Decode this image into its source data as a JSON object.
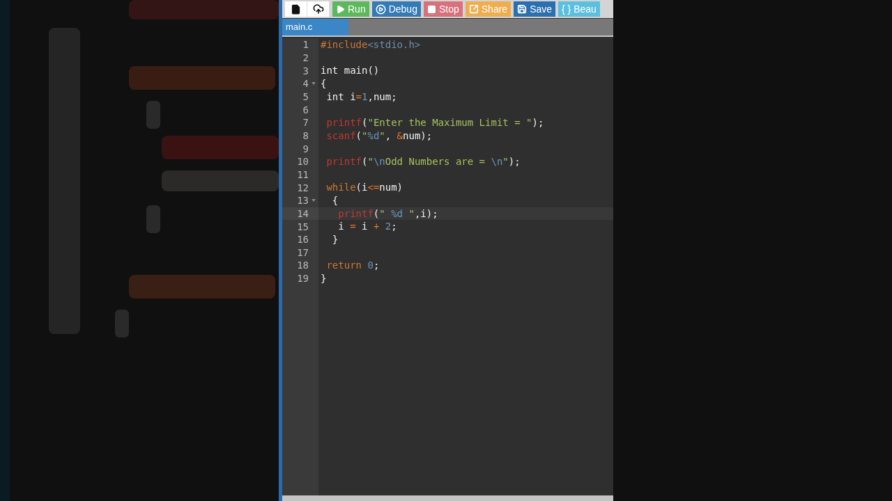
{
  "toolbar": {
    "icon_buttons": [
      {
        "kind": "new-file"
      },
      {
        "kind": "upload"
      }
    ],
    "buttons": [
      {
        "label": "Run",
        "kind": "play",
        "color": "#5cb85c"
      },
      {
        "label": "Debug",
        "kind": "debug",
        "color": "#337ab7"
      },
      {
        "label": "Stop",
        "kind": "stop",
        "color": "#d9707a"
      },
      {
        "label": "Share",
        "kind": "share",
        "color": "#f0ad4e"
      },
      {
        "label": "Save",
        "kind": "save",
        "color": "#2a6fb0"
      },
      {
        "label": "{ } Beau",
        "kind": "text",
        "color": "#5bc0de"
      }
    ]
  },
  "tabs": [
    {
      "label": "main.c",
      "selected": true
    }
  ],
  "editor": {
    "lines": [
      {
        "number": "1",
        "foldable": false,
        "active": false,
        "tokens": [
          {
            "kind": "directive",
            "text": "#include"
          },
          {
            "kind": "header",
            "text": "<stdio.h>"
          }
        ]
      },
      {
        "number": "2",
        "foldable": false,
        "active": false
      },
      {
        "number": "3",
        "foldable": false,
        "active": false,
        "tokens": [
          {
            "kind": "plain",
            "text": "int main()"
          }
        ]
      },
      {
        "number": "4",
        "foldable": true,
        "active": false,
        "tokens": [
          {
            "kind": "plain",
            "text": "{"
          }
        ]
      },
      {
        "number": "5",
        "foldable": false,
        "active": false,
        "tokens": [
          {
            "kind": "plain",
            "text": " int i"
          },
          {
            "kind": "operator",
            "text": "="
          },
          {
            "kind": "number",
            "text": "1"
          },
          {
            "kind": "plain",
            "text": ",num;"
          }
        ]
      },
      {
        "number": "6",
        "foldable": false,
        "active": false
      },
      {
        "number": "7",
        "foldable": false,
        "active": false,
        "tokens": [
          {
            "kind": "func",
            "text": " printf"
          },
          {
            "kind": "plain",
            "text": "("
          },
          {
            "kind": "string",
            "text": "\"Enter the Maximum Limit = \""
          },
          {
            "kind": "plain",
            "text": ");"
          }
        ]
      },
      {
        "number": "8",
        "foldable": false,
        "active": false,
        "tokens": [
          {
            "kind": "func",
            "text": " scanf"
          },
          {
            "kind": "plain",
            "text": "("
          },
          {
            "kind": "string",
            "text": "\""
          },
          {
            "kind": "escape",
            "text": "%d"
          },
          {
            "kind": "string",
            "text": "\""
          },
          {
            "kind": "plain",
            "text": ", "
          },
          {
            "kind": "operator",
            "text": "&"
          },
          {
            "kind": "plain",
            "text": "num);"
          }
        ]
      },
      {
        "number": "9",
        "foldable": false,
        "active": false
      },
      {
        "number": "10",
        "foldable": false,
        "active": false,
        "tokens": [
          {
            "kind": "func",
            "text": " printf"
          },
          {
            "kind": "plain",
            "text": "("
          },
          {
            "kind": "string",
            "text": "\""
          },
          {
            "kind": "escape",
            "text": "\\n"
          },
          {
            "kind": "string",
            "text": "Odd Numbers are = "
          },
          {
            "kind": "escape",
            "text": "\\n"
          },
          {
            "kind": "string",
            "text": "\""
          },
          {
            "kind": "plain",
            "text": ");"
          }
        ]
      },
      {
        "number": "11",
        "foldable": false,
        "active": false
      },
      {
        "number": "12",
        "foldable": false,
        "active": false,
        "tokens": [
          {
            "kind": "keyword",
            "text": " while"
          },
          {
            "kind": "plain",
            "text": "(i"
          },
          {
            "kind": "operator",
            "text": "<="
          },
          {
            "kind": "plain",
            "text": "num)"
          }
        ]
      },
      {
        "number": "13",
        "foldable": true,
        "active": false,
        "tokens": [
          {
            "kind": "plain",
            "text": "  {"
          }
        ]
      },
      {
        "number": "14",
        "foldable": false,
        "active": true,
        "tokens": [
          {
            "kind": "func",
            "text": "   printf"
          },
          {
            "kind": "plain",
            "text": "("
          },
          {
            "kind": "string",
            "text": "\" "
          },
          {
            "kind": "escape",
            "text": "%d"
          },
          {
            "kind": "string",
            "text": " \""
          },
          {
            "kind": "plain",
            "text": ",i);"
          }
        ]
      },
      {
        "number": "15",
        "foldable": false,
        "active": false,
        "tokens": [
          {
            "kind": "plain",
            "text": "   i "
          },
          {
            "kind": "operator",
            "text": "="
          },
          {
            "kind": "plain",
            "text": " i "
          },
          {
            "kind": "operator",
            "text": "+ "
          },
          {
            "kind": "number",
            "text": "2"
          },
          {
            "kind": "plain",
            "text": ";"
          }
        ]
      },
      {
        "number": "16",
        "foldable": false,
        "active": false,
        "tokens": [
          {
            "kind": "plain",
            "text": "  }"
          }
        ]
      },
      {
        "number": "17",
        "foldable": false,
        "active": false
      },
      {
        "number": "18",
        "foldable": false,
        "active": false,
        "tokens": [
          {
            "kind": "keyword",
            "text": " return "
          },
          {
            "kind": "number",
            "text": "0"
          },
          {
            "kind": "plain",
            "text": ";"
          }
        ]
      },
      {
        "number": "19",
        "foldable": false,
        "active": false,
        "tokens": [
          {
            "kind": "plain",
            "text": "}"
          }
        ]
      }
    ]
  }
}
